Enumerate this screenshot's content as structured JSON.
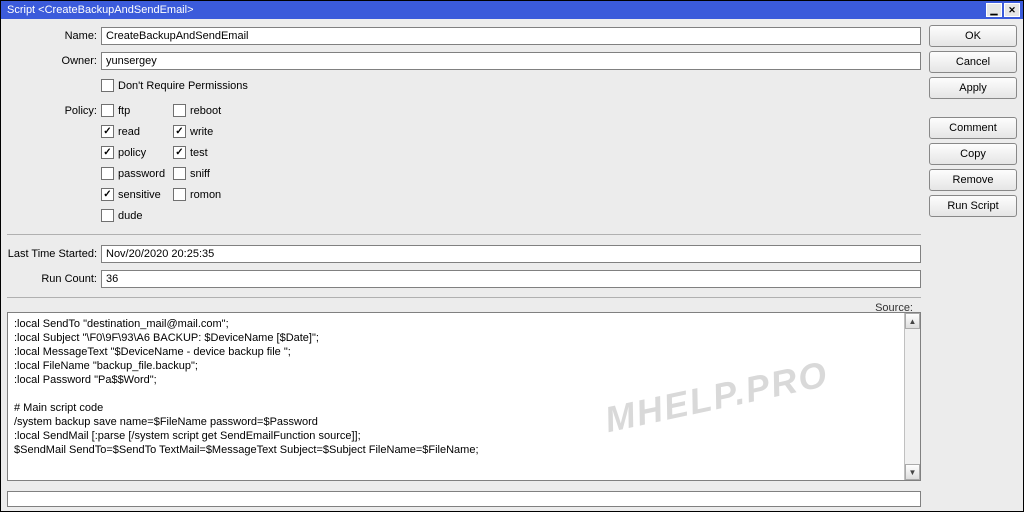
{
  "window": {
    "title": "Script <CreateBackupAndSendEmail>",
    "min_glyph": "▁",
    "close_glyph": "✕"
  },
  "buttons": {
    "ok": "OK",
    "cancel": "Cancel",
    "apply": "Apply",
    "comment": "Comment",
    "copy": "Copy",
    "remove": "Remove",
    "run_script": "Run Script"
  },
  "labels": {
    "name": "Name:",
    "owner": "Owner:",
    "policy": "Policy:",
    "last_started": "Last Time Started:",
    "run_count": "Run Count:",
    "source": "Source:",
    "dont_require": "Don't Require Permissions"
  },
  "fields": {
    "name": "CreateBackupAndSendEmail",
    "owner": "yunsergey",
    "last_started": "Nov/20/2020 20:25:35",
    "run_count": "36"
  },
  "policy": [
    [
      {
        "id": "ftp",
        "label": "ftp",
        "checked": false
      },
      {
        "id": "reboot",
        "label": "reboot",
        "checked": false
      }
    ],
    [
      {
        "id": "read",
        "label": "read",
        "checked": true
      },
      {
        "id": "write",
        "label": "write",
        "checked": true
      }
    ],
    [
      {
        "id": "policy",
        "label": "policy",
        "checked": true
      },
      {
        "id": "test",
        "label": "test",
        "checked": true
      }
    ],
    [
      {
        "id": "password",
        "label": "password",
        "checked": false
      },
      {
        "id": "sniff",
        "label": "sniff",
        "checked": false
      }
    ],
    [
      {
        "id": "sensitive",
        "label": "sensitive",
        "checked": true
      },
      {
        "id": "romon",
        "label": "romon",
        "checked": false
      }
    ],
    [
      {
        "id": "dude",
        "label": "dude",
        "checked": false
      }
    ]
  ],
  "dont_require_checked": false,
  "source_code": ":local SendTo \"destination_mail@mail.com\";\n:local Subject \"\\F0\\9F\\93\\A6 BACKUP: $DeviceName [$Date]\";\n:local MessageText \"$DeviceName - device backup file \";\n:local FileName \"backup_file.backup\";\n:local Password \"Pa$$Word\";\n\n# Main script code\n/system backup save name=$FileName password=$Password\n:local SendMail [:parse [/system script get SendEmailFunction source]];\n$SendMail SendTo=$SendTo TextMail=$MessageText Subject=$Subject FileName=$FileName;",
  "watermark": "MHELP.PRO"
}
